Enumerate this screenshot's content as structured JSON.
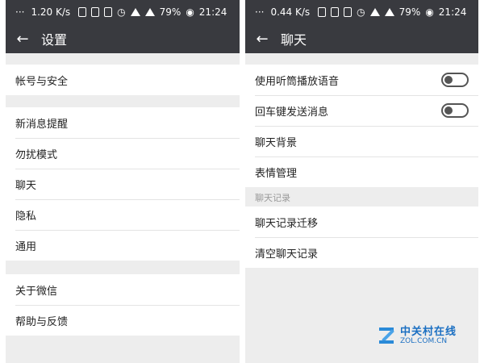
{
  "left": {
    "status": {
      "dots": "···",
      "speed": "1.20 K/s",
      "battery": "79%",
      "time": "21:24"
    },
    "title": "设置",
    "sections": [
      {
        "items": [
          {
            "label": "帐号与安全"
          }
        ]
      },
      {
        "items": [
          {
            "label": "新消息提醒"
          },
          {
            "label": "勿扰模式"
          },
          {
            "label": "聊天"
          },
          {
            "label": "隐私"
          },
          {
            "label": "通用"
          }
        ]
      },
      {
        "items": [
          {
            "label": "关于微信"
          },
          {
            "label": "帮助与反馈"
          }
        ]
      }
    ]
  },
  "right": {
    "status": {
      "dots": "···",
      "speed": "0.44 K/s",
      "battery": "79%",
      "time": "21:24"
    },
    "title": "聊天",
    "section1": [
      {
        "label": "使用听筒播放语音",
        "toggle": false
      },
      {
        "label": "回车键发送消息",
        "toggle": false
      },
      {
        "label": "聊天背景"
      },
      {
        "label": "表情管理"
      }
    ],
    "history_header": "聊天记录",
    "section2": [
      {
        "label": "聊天记录迁移"
      },
      {
        "label": "清空聊天记录"
      }
    ]
  },
  "watermark": {
    "name": "中关村在线",
    "url": "ZOL.COM.CN"
  },
  "colors": {
    "bar": "#393a3f",
    "page_bg": "#ededed",
    "watermark": "#1b6fc2"
  }
}
